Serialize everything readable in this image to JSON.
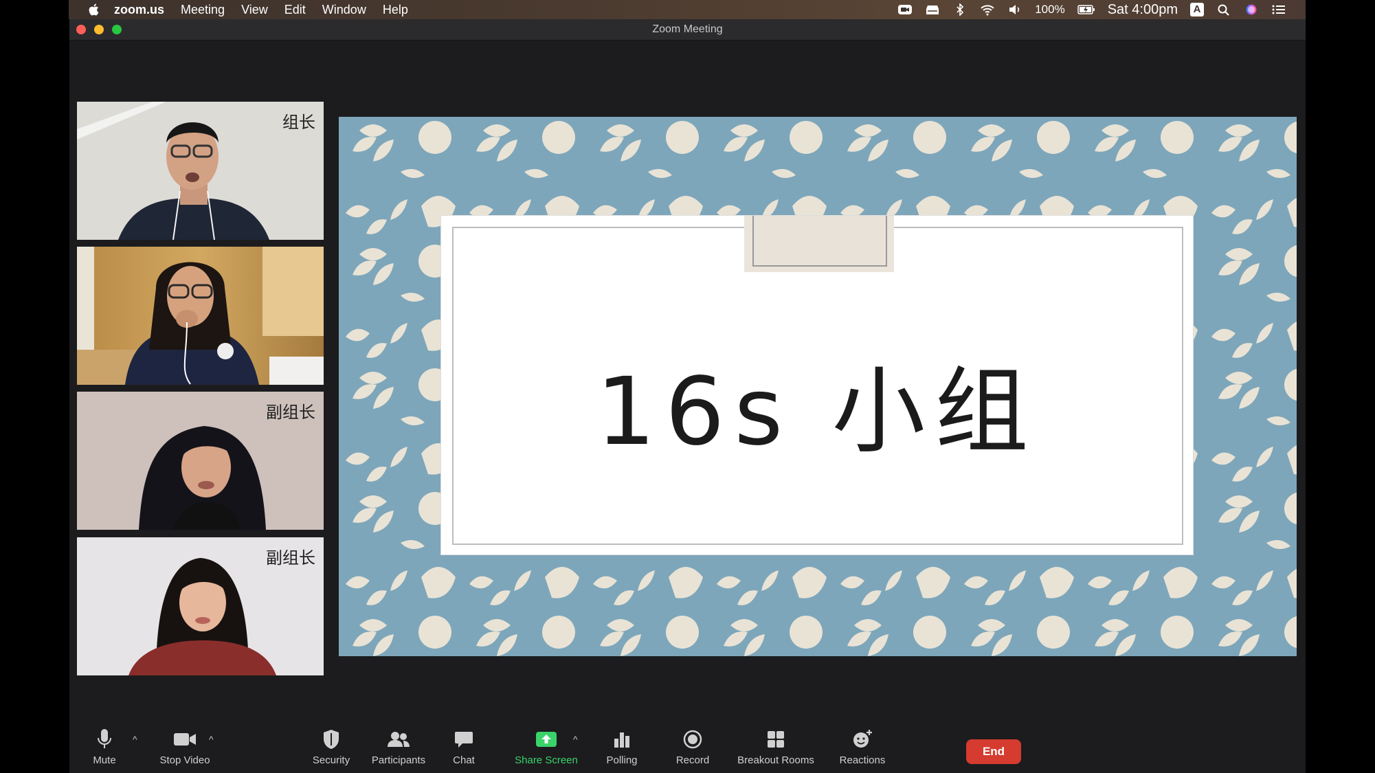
{
  "menubar": {
    "app_name": "zoom.us",
    "menus": [
      "Meeting",
      "View",
      "Edit",
      "Window",
      "Help"
    ],
    "battery": "100%",
    "clock": "Sat 4:00pm",
    "input_source": "A"
  },
  "window": {
    "title": "Zoom Meeting"
  },
  "participants": [
    {
      "label": "组长"
    },
    {
      "label": ""
    },
    {
      "label": "副组长"
    },
    {
      "label": "副组长"
    }
  ],
  "slide": {
    "title": "16s 小组"
  },
  "toolbar": {
    "mute": "Mute",
    "stop_video": "Stop Video",
    "security": "Security",
    "participants": "Participants",
    "chat": "Chat",
    "share_screen": "Share Screen",
    "polling": "Polling",
    "record": "Record",
    "breakout_rooms": "Breakout Rooms",
    "reactions": "Reactions",
    "end": "End"
  },
  "colors": {
    "share_green": "#3ad36a",
    "end_red": "#d53b2f",
    "slide_blue": "#7da6ba"
  }
}
